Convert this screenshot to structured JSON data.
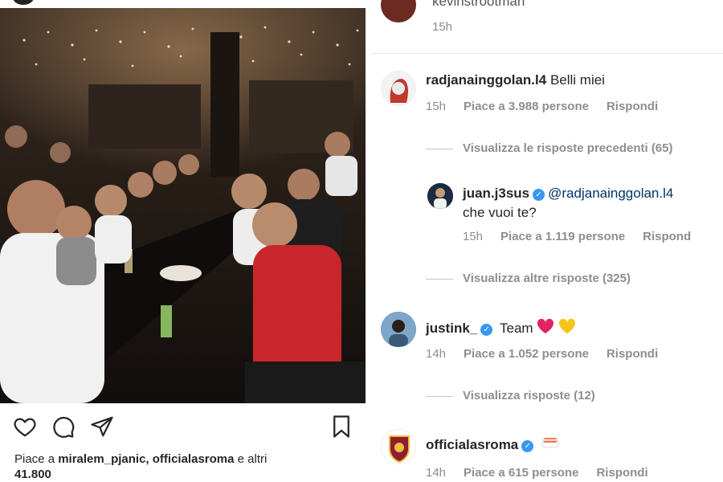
{
  "post": {
    "likes_prefix": "Piace a ",
    "likes_users": "miralem_pjanic, officialasroma",
    "likes_suffix": " e altri",
    "likes_count": "41.800"
  },
  "top_comment": {
    "username": "kevinstrootman",
    "time": "15h"
  },
  "comments": [
    {
      "username": "radjanainggolan.l4",
      "text": "Belli miei",
      "time": "15h",
      "likes": "Piace a 3.988 persone",
      "reply": "Rispondi",
      "view_replies": "Visualizza le risposte precedenti (65)"
    },
    {
      "username": "juan.j3sus",
      "mention": "@radjanainggolan.l4",
      "text": "che vuoi te?",
      "time": "15h",
      "likes": "Piace a 1.119 persone",
      "reply": "Rispond",
      "view_replies": "Visualizza altre risposte (325)"
    },
    {
      "username": "justink_",
      "text": "Team",
      "time": "14h",
      "likes": "Piace a 1.052 persone",
      "reply": "Rispondi",
      "view_replies": "Visualizza risposte (12)"
    },
    {
      "username": "officialasroma",
      "text": "",
      "time": "14h",
      "likes": "Piace a 615 persone",
      "reply": "Rispondi"
    }
  ],
  "icons": {
    "like": "heart-icon",
    "comment": "comment-icon",
    "share": "share-icon",
    "save": "bookmark-icon",
    "verified": "verified-badge-icon"
  },
  "colors": {
    "verified": "#3897f0",
    "muted": "#8e8e8e",
    "text": "#262626",
    "mention": "#003569"
  }
}
